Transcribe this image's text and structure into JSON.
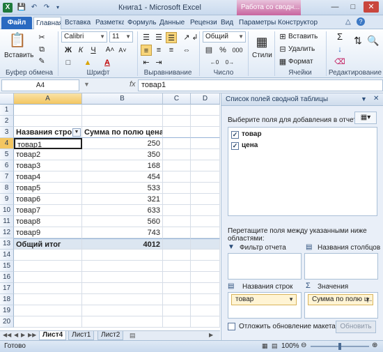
{
  "titlebar": {
    "title": "Книга1 - Microsoft Excel",
    "context_tab": "Работа со сводн..."
  },
  "ribbon_tabs": [
    "Файл",
    "Главная",
    "Вставка",
    "Разметка",
    "Формуль",
    "Данные",
    "Рецензи",
    "Вид",
    "Параметры",
    "Конструктор"
  ],
  "ribbon": {
    "paste_label": "Вставить",
    "font_name": "Calibri",
    "font_size": "11",
    "number_format": "Общий",
    "percent_symbol": "%",
    "thousands_symbol": "000",
    "styles_label": "Стили",
    "insert_label": "Вставить",
    "delete_label": "Удалить",
    "format_label": "Формат",
    "groups": {
      "clipboard": "Буфер обмена",
      "font": "Шрифт",
      "alignment": "Выравнивание",
      "number": "Число",
      "cells": "Ячейки",
      "editing": "Редактирование"
    }
  },
  "formula_bar": {
    "cell_ref": "A4",
    "fx": "fx",
    "value": "товар1"
  },
  "grid": {
    "columns": [
      "A",
      "B",
      "C",
      "D"
    ],
    "row_numbers": [
      "1",
      "2",
      "3",
      "4",
      "5",
      "6",
      "7",
      "8",
      "9",
      "10",
      "11",
      "12",
      "13",
      "14",
      "15",
      "16",
      "17",
      "18",
      "19",
      "20"
    ],
    "header_row": {
      "a": "Названия строк",
      "b": "Сумма по полю цена"
    },
    "data_rows": [
      {
        "a": "товар1",
        "b": "250"
      },
      {
        "a": "товар2",
        "b": "350"
      },
      {
        "a": "товар3",
        "b": "168"
      },
      {
        "a": "товар4",
        "b": "454"
      },
      {
        "a": "товар5",
        "b": "533"
      },
      {
        "a": "товар6",
        "b": "321"
      },
      {
        "a": "товар7",
        "b": "633"
      },
      {
        "a": "товар8",
        "b": "560"
      },
      {
        "a": "товар9",
        "b": "743"
      }
    ],
    "total_row": {
      "a": "Общий итог",
      "b": "4012"
    }
  },
  "sheet_tabs": [
    "Лист4",
    "Лист1",
    "Лист2"
  ],
  "status": {
    "ready": "Готово",
    "zoom": "100%"
  },
  "pivot_panel": {
    "title": "Список полей сводной таблицы",
    "choose_fields": "Выберите поля для добавления в отчет:",
    "fields": [
      "товар",
      "цена"
    ],
    "drag_hint_1": "Перетащите поля между указанными ниже",
    "drag_hint_2": "областями:",
    "areas": {
      "filter": "Фильтр отчета",
      "columns": "Названия столбцов",
      "rows": "Названия строк",
      "values": "Значения"
    },
    "row_field": "товар",
    "value_field": "Сумма по полю ц...",
    "defer_label": "Отложить обновление макета",
    "update_button": "Обновить"
  },
  "colors": {
    "file_tab": "#2a6ac1",
    "context_tab": "#c8669f",
    "total_row_fill": "#dce6f1"
  }
}
